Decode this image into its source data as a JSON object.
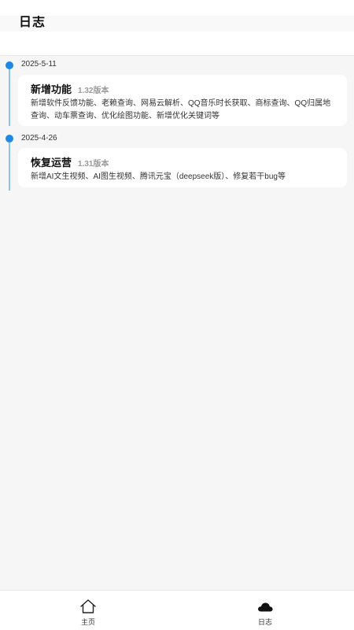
{
  "header": {
    "title": "日志"
  },
  "timeline": [
    {
      "date": "2025-5-11",
      "title": "新增功能",
      "version": "1.32版本",
      "description": "新增软件反馈功能、老赖查询、网易云解析、QQ音乐时长获取、商标查询、QQ归属地查询、动车票查询、优化绘图功能、新增优化关键词等"
    },
    {
      "date": "2025-4-26",
      "title": "恢复运营",
      "version": "1.31版本",
      "description": "新增AI文生视频、AI图生视频、腾讯元宝（deepseek版）、修复若干bug等"
    }
  ],
  "nav": {
    "home": {
      "label": "主页",
      "icon": "home-icon"
    },
    "log": {
      "label": "日志",
      "icon": "cloud-icon"
    }
  },
  "colors": {
    "accent": "#1e88e5",
    "line": "#8cc3f0"
  }
}
